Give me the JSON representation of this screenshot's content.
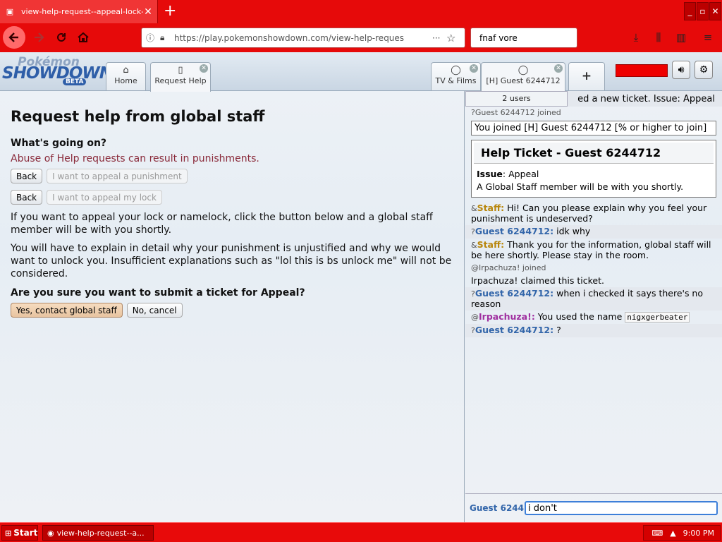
{
  "browser": {
    "tab_title": "view-help-request--appeal-lock-o",
    "url": "https://play.pokemonshowdown.com/view-help-reques",
    "search_value": "fnaf vore",
    "min": "_",
    "max": "▫",
    "close": "✕"
  },
  "logo": {
    "line1": "Pokémon",
    "line2": "SHOWDOWN",
    "line3": "BETA"
  },
  "ps_tabs": [
    {
      "label": "Home",
      "icon": "⌂"
    },
    {
      "label": "Request Help",
      "icon": "▯"
    },
    {
      "label": "TV & Films",
      "icon": "◯"
    },
    {
      "label": "[H] Guest 6244712",
      "icon": "◯"
    },
    {
      "label": "+"
    }
  ],
  "main": {
    "title": "Request help from global staff",
    "q1": "What's going on?",
    "warning": "Abuse of Help requests can result in punishments.",
    "back": "Back",
    "opt1": "I want to appeal a punishment",
    "opt2": "I want to appeal my lock",
    "p1": "If you want to appeal your lock or namelock, click the button below and a global staff member will be with you shortly.",
    "p2": "You will have to explain in detail why your punishment is unjustified and why we would want to unlock you. Insufficient explanations such as \"lol this is bs unlock me\" will not be considered.",
    "q2": "Are you sure you want to submit a ticket for Appeal?",
    "yes": "Yes, contact global staff",
    "no": "No, cancel"
  },
  "chat": {
    "users": "2 users",
    "line0": "ed a new ticket. Issue: Appeal",
    "join1": "?Guest 6244712 joined",
    "joinbox": "You joined [H] Guest 6244712 [% or higher to join]",
    "ticket_title": "Help Ticket - Guest 6244712",
    "issue_label": "Issue",
    "issue_value": ": Appeal",
    "ticket_note": "A Global Staff member will be with you shortly.",
    "m1_rank": "&",
    "m1_name": "Staff:",
    "m1_text": " Hi! Can you please explain why you feel your punishment is undeserved?",
    "m2_rank": "?",
    "m2_name": "Guest 6244712:",
    "m2_text": " idk why",
    "m3_rank": "&",
    "m3_name": "Staff:",
    "m3_text": " Thank you for the information, global staff will be here shortly. Please stay in the room.",
    "join2": "@Irpachuza! joined",
    "claim": "Irpachuza! claimed this ticket.",
    "m4_rank": "?",
    "m4_name": "Guest 6244712:",
    "m4_text": " when i checked it says there's no reason",
    "m5_rank": "@",
    "m5_name": "Irpachuza!:",
    "m5_text": " You used the name ",
    "m5_code": "nigxgerbeater",
    "m6_rank": "?",
    "m6_name": "Guest 6244712:",
    "m6_text": " ?",
    "composer_user": "Guest 6244",
    "composer_value": "i don't"
  },
  "taskbar": {
    "start": "Start",
    "item": "view-help-request--a...",
    "time": "9:00 PM"
  }
}
